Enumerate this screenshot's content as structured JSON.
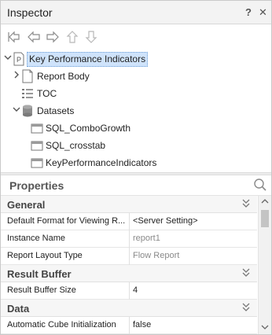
{
  "window": {
    "title": "Inspector",
    "help_label": "?",
    "close_label": "✕"
  },
  "toolbar": {
    "buttons": [
      "home-icon",
      "back-icon",
      "forward-icon",
      "up-icon",
      "down-icon"
    ]
  },
  "tree": {
    "root": {
      "label": "Key Performance Indicators",
      "icon": "report-p-icon"
    },
    "items": [
      {
        "label": "Report Body",
        "icon": "page-icon"
      },
      {
        "label": "TOC",
        "icon": "list-icon"
      },
      {
        "label": "Datasets",
        "icon": "database-icon"
      },
      {
        "label": "SQL_ComboGrowth",
        "icon": "table-icon"
      },
      {
        "label": "SQL_crosstab",
        "icon": "table-icon"
      },
      {
        "label": "KeyPerformanceIndicators",
        "icon": "table-icon"
      }
    ]
  },
  "properties": {
    "title": "Properties",
    "categories": [
      {
        "name": "General",
        "rows": [
          {
            "key": "Default Format for Viewing R...",
            "value": "<Server Setting>",
            "muted": false
          },
          {
            "key": "Instance Name",
            "value": "report1",
            "muted": true
          },
          {
            "key": "Report Layout Type",
            "value": "Flow Report",
            "muted": true
          }
        ]
      },
      {
        "name": "Result Buffer",
        "rows": [
          {
            "key": "Result Buffer Size",
            "value": "4",
            "muted": false
          }
        ]
      },
      {
        "name": "Data",
        "rows": [
          {
            "key": "Automatic Cube Initialization",
            "value": "false",
            "muted": false
          }
        ]
      }
    ]
  },
  "colors": {
    "selection": "#cfe3fb",
    "muted_text": "#8a8a8a"
  }
}
